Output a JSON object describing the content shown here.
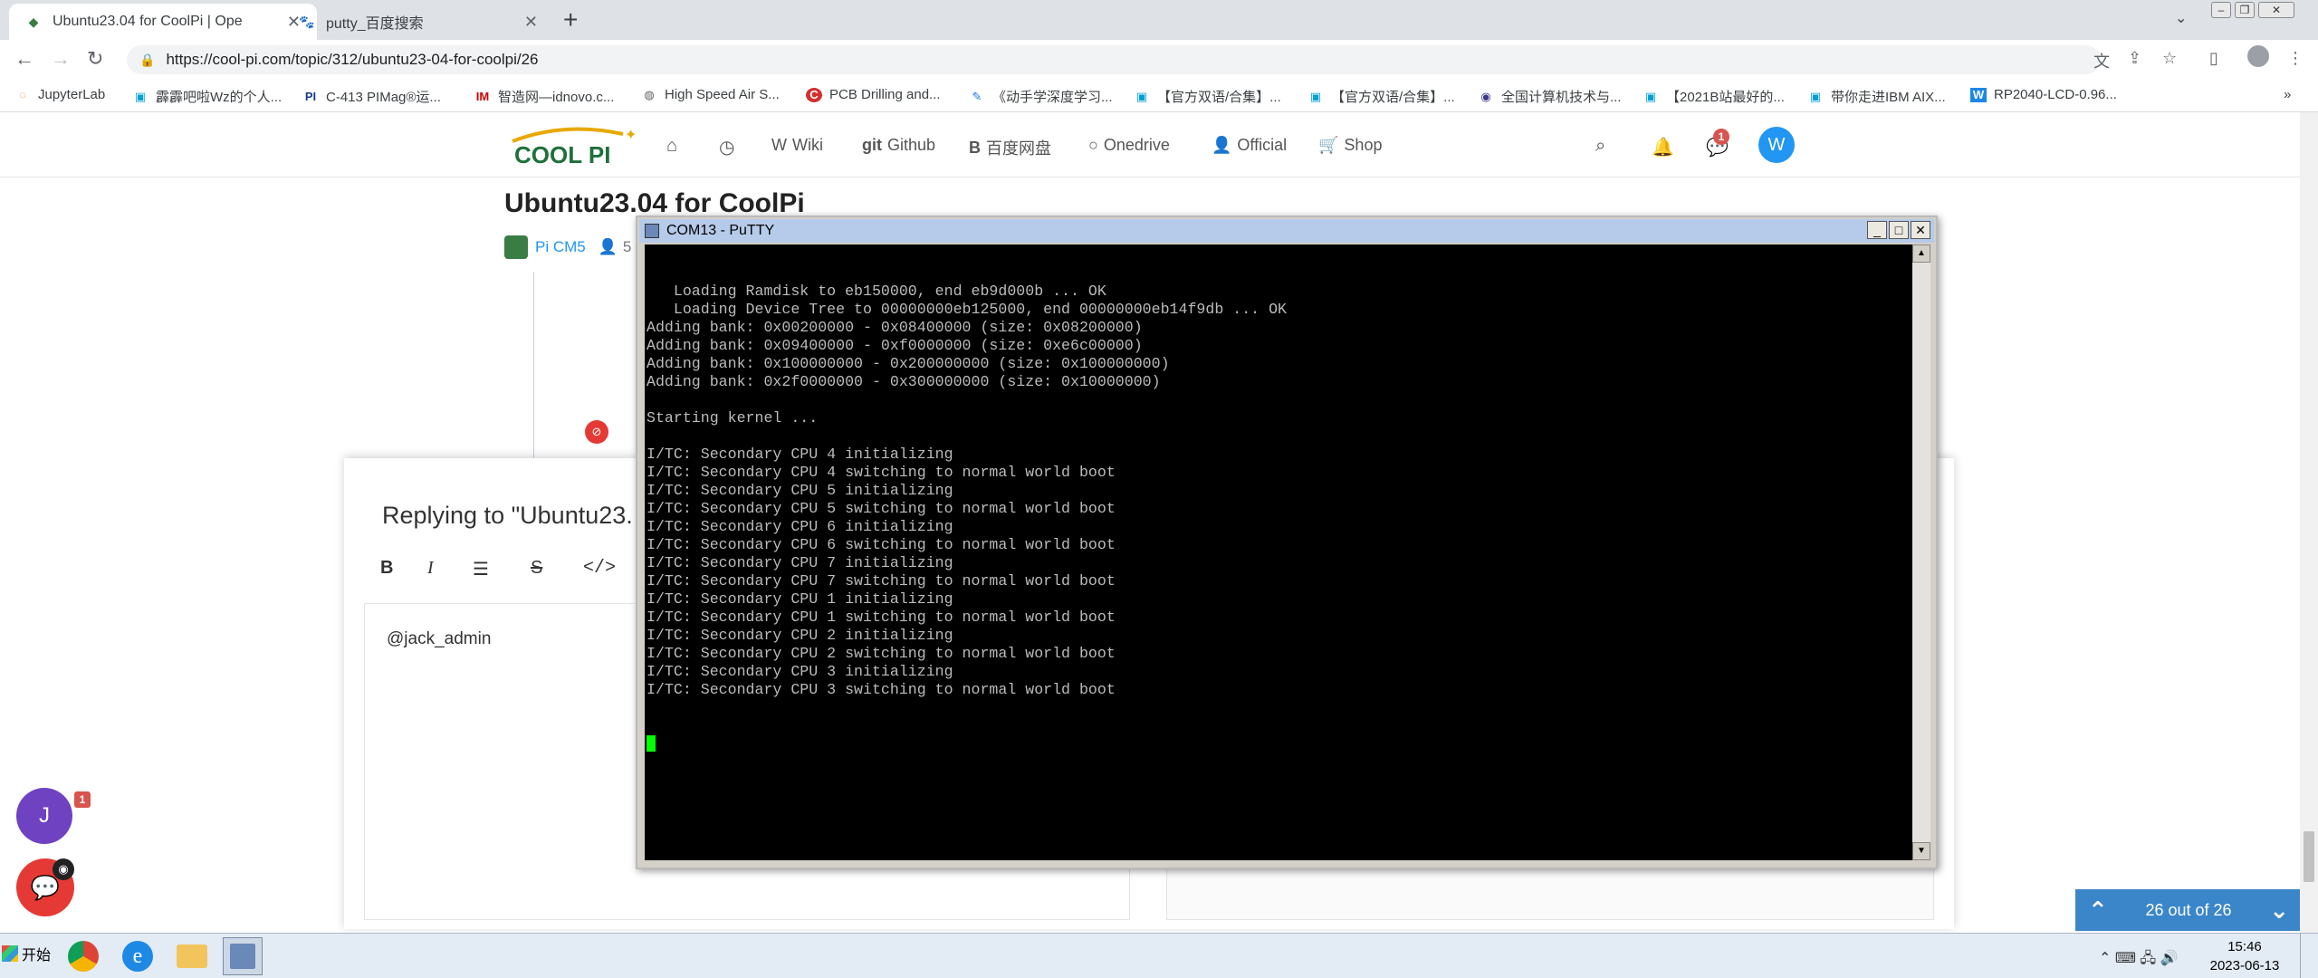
{
  "browser": {
    "tabs": [
      {
        "title": "Ubuntu23.04 for CoolPi | Ope",
        "active": true
      },
      {
        "title": "putty_百度搜索",
        "active": false
      }
    ],
    "url": "https://cool-pi.com/topic/312/ubuntu23-04-for-coolpi/26",
    "bookmarks": [
      "JupyterLab",
      "霹霹吧啦Wz的个人...",
      "C-413 PIMag®运...",
      "智造网—idnovo.c...",
      "High Speed Air S...",
      "PCB Drilling and...",
      "《动手学深度学习...",
      "【官方双语/合集】...",
      "【官方双语/合集】...",
      "全国计算机技术与...",
      "【2021B站最好的...",
      "带你走进IBM AIX...",
      "RP2040-LCD-0.96..."
    ],
    "bookmark_more": "»"
  },
  "site": {
    "logo_text": "COOL PI",
    "nav": [
      {
        "label": "Wiki",
        "icon": "W"
      },
      {
        "label": "Github",
        "icon": "git"
      },
      {
        "label": "百度网盘",
        "icon": "B"
      },
      {
        "label": "Onedrive",
        "icon": "○"
      },
      {
        "label": "Official",
        "icon": "👤"
      },
      {
        "label": "Shop",
        "icon": "🛒"
      }
    ],
    "chat_badge": "1",
    "user_initial": "W"
  },
  "topic": {
    "title": "Ubuntu23.04 for CoolPi",
    "category": "Pi CM5",
    "posters": "5"
  },
  "composer": {
    "title": "Replying to \"Ubuntu23.",
    "editor_text": "@jack_admin"
  },
  "floating": {
    "chat_initial": "J",
    "chat_badge": "1"
  },
  "pager": {
    "text": "26 out of 26"
  },
  "putty": {
    "title": "COM13 - PuTTY",
    "lines": [
      "   Loading Ramdisk to eb150000, end eb9d000b ... OK",
      "   Loading Device Tree to 00000000eb125000, end 00000000eb14f9db ... OK",
      "Adding bank: 0x00200000 - 0x08400000 (size: 0x08200000)",
      "Adding bank: 0x09400000 - 0xf0000000 (size: 0xe6c00000)",
      "Adding bank: 0x100000000 - 0x200000000 (size: 0x100000000)",
      "Adding bank: 0x2f0000000 - 0x300000000 (size: 0x10000000)",
      "",
      "Starting kernel ...",
      "",
      "I/TC: Secondary CPU 4 initializing",
      "I/TC: Secondary CPU 4 switching to normal world boot",
      "I/TC: Secondary CPU 5 initializing",
      "I/TC: Secondary CPU 5 switching to normal world boot",
      "I/TC: Secondary CPU 6 initializing",
      "I/TC: Secondary CPU 6 switching to normal world boot",
      "I/TC: Secondary CPU 7 initializing",
      "I/TC: Secondary CPU 7 switching to normal world boot",
      "I/TC: Secondary CPU 1 initializing",
      "I/TC: Secondary CPU 1 switching to normal world boot",
      "I/TC: Secondary CPU 2 initializing",
      "I/TC: Secondary CPU 2 switching to normal world boot",
      "I/TC: Secondary CPU 3 initializing",
      "I/TC: Secondary CPU 3 switching to normal world boot"
    ]
  },
  "taskbar": {
    "start": "开始",
    "time": "15:46",
    "date": "2023-06-13"
  },
  "colors": {
    "accent": "#2196f3",
    "cursor": "#00ff00",
    "pager": "#3a86c8"
  }
}
